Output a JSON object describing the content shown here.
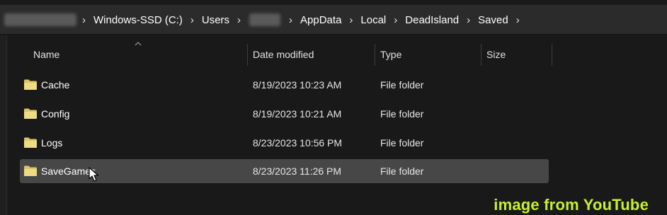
{
  "breadcrumb": {
    "items": [
      "Windows-SSD (C:)",
      "Users",
      "AppData",
      "Local",
      "DeadIsland",
      "Saved"
    ],
    "separator": "›"
  },
  "columns": {
    "name": "Name",
    "date_modified": "Date modified",
    "type": "Type",
    "size": "Size"
  },
  "rows": [
    {
      "name": "Cache",
      "date": "8/19/2023 10:23 AM",
      "type": "File folder",
      "size": "",
      "selected": false
    },
    {
      "name": "Config",
      "date": "8/19/2023 10:21 AM",
      "type": "File folder",
      "size": "",
      "selected": false
    },
    {
      "name": "Logs",
      "date": "8/23/2023 10:56 PM",
      "type": "File folder",
      "size": "",
      "selected": false
    },
    {
      "name": "SaveGames",
      "date": "8/23/2023 11:26 PM",
      "type": "File folder",
      "size": "",
      "selected": true
    }
  ],
  "watermark": "image from YouTube",
  "colors": {
    "background": "#191919",
    "selected_row": "#474747",
    "folder": "#e8d27a",
    "watermark": "#c8f02c"
  },
  "icons": {
    "folder": "folder-icon",
    "sort": "sort-ascending-icon",
    "chevron": "chevron-right-icon",
    "cursor": "mouse-pointer-icon"
  }
}
